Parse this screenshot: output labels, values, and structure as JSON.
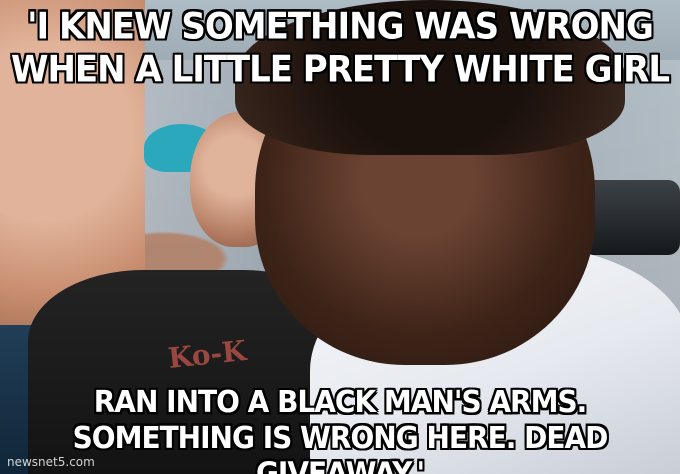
{
  "meme": {
    "top_text_lines": [
      "'I KNEW SOMETHING WAS WRONG",
      "WHEN A LITTLE PRETTY WHITE GIRL"
    ],
    "bottom_text_lines": [
      "RAN INTO A BLACK MAN'S ARMS.",
      "SOMETHING IS WRONG HERE. DEAD GIVEAWAY.'"
    ],
    "shirt_print": "Ko-K",
    "watermark": "newsnet5.com"
  },
  "colors": {
    "caption_fill": "#ffffff",
    "caption_stroke": "#000000",
    "cap_blue": "#2ba8bb",
    "shirt_white": "#f7f8fb"
  }
}
